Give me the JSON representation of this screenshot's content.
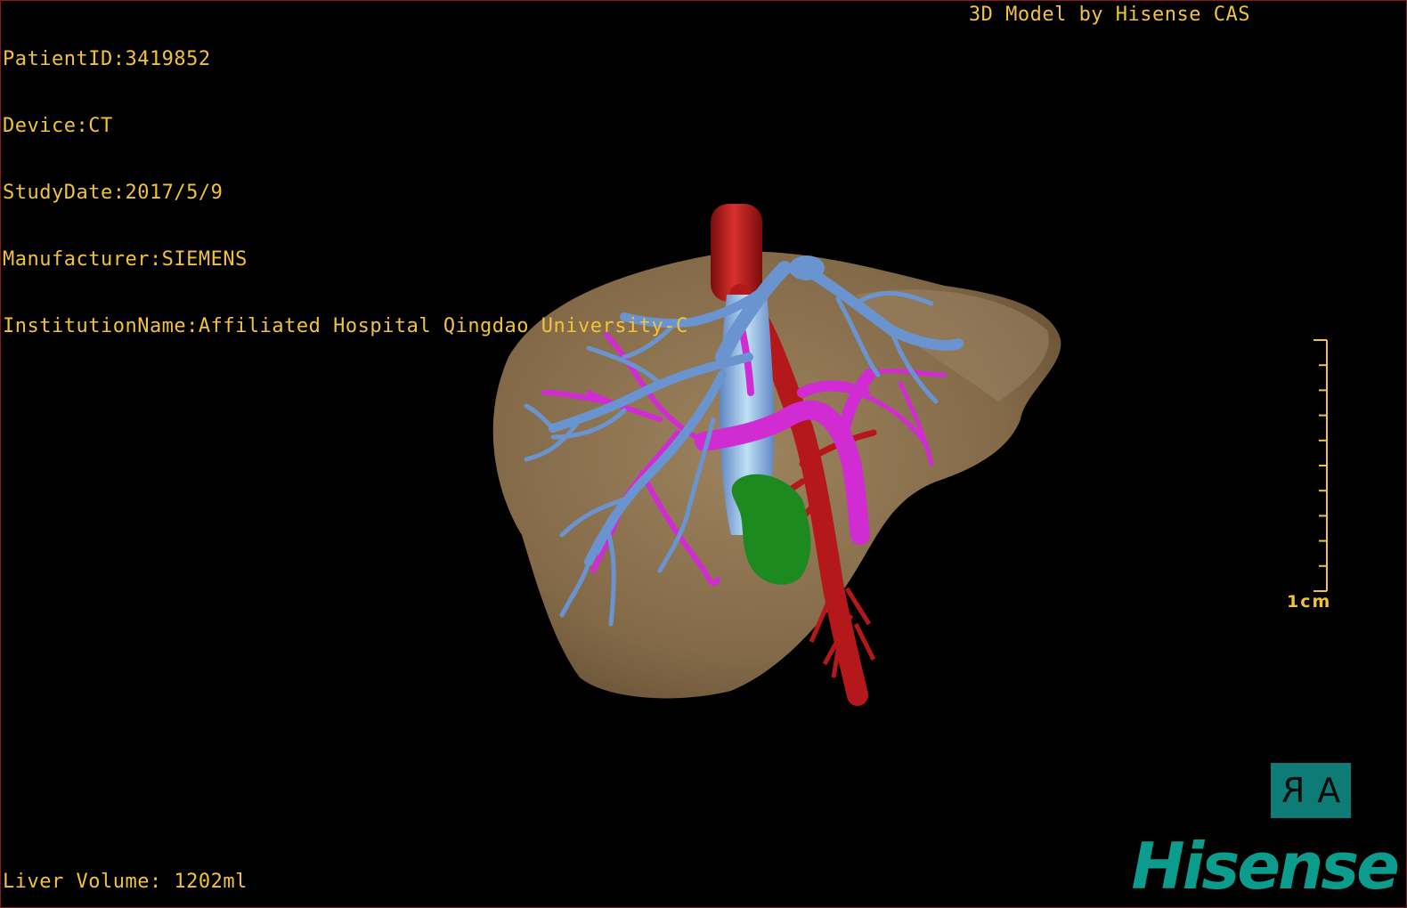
{
  "window": {
    "background_color": "#000000",
    "text_color": "#f2c23a"
  },
  "header_info": {
    "patient_id": "PatientID:3419852",
    "device": "Device:CT",
    "study_date": "StudyDate:2017/5/9",
    "manufacturer": "Manufacturer:SIEMENS",
    "institution": "InstitutionName:Affiliated Hospital Qingdao University-C"
  },
  "credit": "3D Model by Hisense CAS",
  "footer": {
    "liver_volume": "Liver Volume: 1202ml"
  },
  "scale_bar": {
    "label": "1cm",
    "tick_count": 10
  },
  "orientation_marker": {
    "left_letter": "R",
    "right_letter": "A"
  },
  "brand": {
    "name": "Hisense",
    "color": "#0c9c8e"
  },
  "model_colors": {
    "liver": "#8a6f4c",
    "hepatic_vein": "#6a94d0",
    "portal_vein": "#d12bd4",
    "artery": "#b5181a",
    "lesion": "#1d8a1f"
  }
}
